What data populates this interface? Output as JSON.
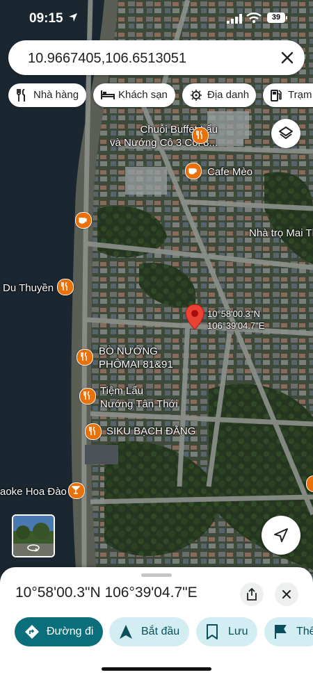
{
  "status_bar": {
    "time": "09:15",
    "battery": "39"
  },
  "search": {
    "value": "10.9667405,106.6513051"
  },
  "chips": [
    {
      "label": "Nhà hàng",
      "icon": "fork-knife-icon"
    },
    {
      "label": "Khách sạn",
      "icon": "bed-icon"
    },
    {
      "label": "Địa danh",
      "icon": "landmark-icon"
    },
    {
      "label": "Trạm",
      "icon": "fuel-icon"
    }
  ],
  "map": {
    "pois": [
      {
        "name": "Chuỗi Buffet Lẩu và Nướng Cô 3 Còi 8...",
        "lines": [
          "Chuỗi Buffet Lẩu",
          "và Nướng Cô 3 Còi 8..."
        ],
        "icon": "restaurant-icon",
        "color": "#e8710a"
      },
      {
        "name": "Cafe Mèo",
        "lines": [
          "Cafe Mèo"
        ],
        "icon": "cafe-icon",
        "color": "#e8710a"
      },
      {
        "name": "Nhà trọ Mai Th",
        "lines": [
          "Nhà trọ Mai Th"
        ],
        "icon": "",
        "color": ""
      },
      {
        "name": "Du Thuyền",
        "lines": [
          "Du Thuyền"
        ],
        "icon": "restaurant-icon",
        "color": "#e8710a"
      },
      {
        "name": "BÒ NƯỚNG PHÔMAI 81&91",
        "lines": [
          "BÒ NƯỚNG",
          "PHÔMAI 81&91"
        ],
        "icon": "restaurant-icon",
        "color": "#e8710a"
      },
      {
        "name": "Tiệm Lẩu Nướng Tân Thới",
        "lines": [
          "Tiệm Lẩu",
          "Nướng Tân Thới"
        ],
        "icon": "restaurant-icon",
        "color": "#e8710a"
      },
      {
        "name": "SIKU BẠCH ĐẰNG",
        "lines": [
          "SIKU BẠCH ĐẰNG"
        ],
        "icon": "restaurant-icon",
        "color": "#e8710a"
      },
      {
        "name": "aoke Hoa Đào",
        "lines": [
          "aoke Hoa Đào"
        ],
        "icon": "bar-icon",
        "color": "#e8710a"
      }
    ],
    "pin": {
      "lines": [
        "10°58'00.3\"N",
        "106°39'04.7\"E"
      ],
      "color": "#ea4335"
    }
  },
  "sheet": {
    "coordinates": "10°58'00.3\"N 106°39'04.7\"E",
    "actions": [
      {
        "label": "Đường đi",
        "icon": "directions-icon",
        "primary": true
      },
      {
        "label": "Bắt đầu",
        "icon": "navigation-icon",
        "primary": false
      },
      {
        "label": "Lưu",
        "icon": "bookmark-icon",
        "primary": false
      },
      {
        "label": "Thê",
        "icon": "flag-icon",
        "primary": false
      }
    ]
  },
  "colors": {
    "accent": "#0a6f7b",
    "accent_light": "#d3eef3",
    "poi": "#e8710a",
    "pin": "#ea4335"
  }
}
